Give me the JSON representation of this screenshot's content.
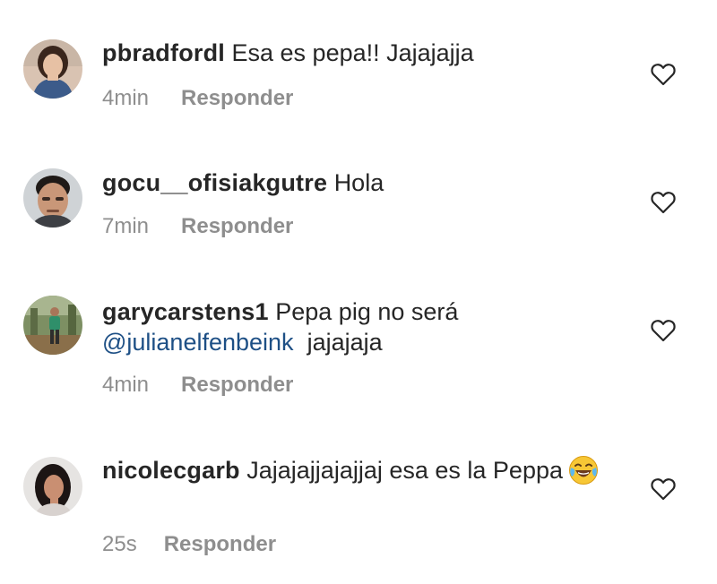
{
  "comments": [
    {
      "username": "pbradfordl",
      "text": "Esa es pepa!! Jajajajja",
      "time": "4min",
      "reply_label": "Responder"
    },
    {
      "username": "gocu__ofisiakgutre",
      "text": "Hola",
      "time": "7min",
      "reply_label": "Responder"
    },
    {
      "username": "garycarstens1",
      "text": "Pepa pig no será",
      "mention": "@julianelfenbeink",
      "text_after": "jajajaja",
      "time": "4min",
      "reply_label": "Responder"
    },
    {
      "username": "nicolecgarb",
      "text": "Jajajajjajajjaj esa es la Peppa",
      "emoji": "face-with-tears-of-joy",
      "time": "25s",
      "reply_label": "Responder"
    }
  ],
  "colors": {
    "text": "#262626",
    "meta": "#8e8e8e",
    "mention": "#1d4f85"
  },
  "icons": [
    "heart-outline-icon",
    "face-with-tears-of-joy-emoji"
  ]
}
